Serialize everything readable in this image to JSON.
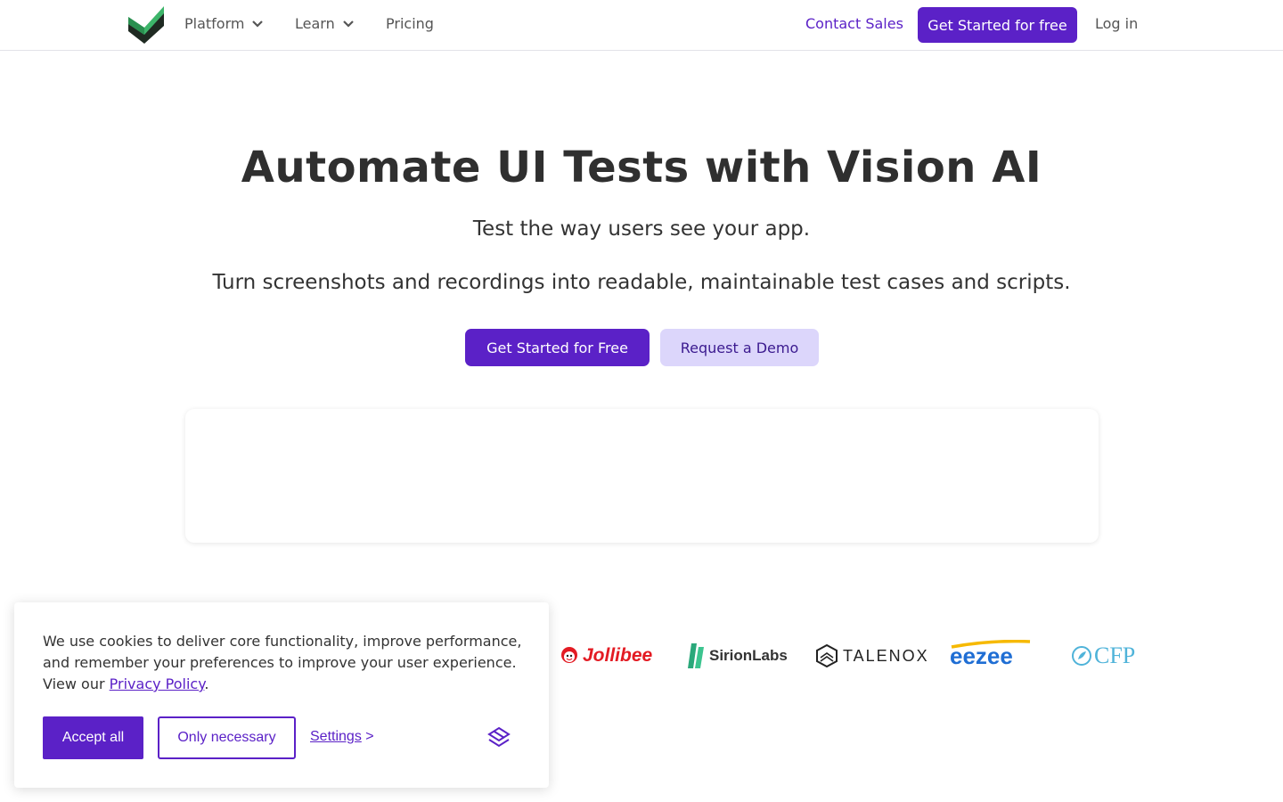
{
  "nav": {
    "logo_icon": "green-check-box-logo",
    "items": [
      {
        "label": "Platform",
        "has_dropdown": true
      },
      {
        "label": "Learn",
        "has_dropdown": true
      },
      {
        "label": "Pricing",
        "has_dropdown": false
      }
    ],
    "contact_sales": "Contact Sales",
    "cta": "Get Started for free",
    "login": "Log in"
  },
  "hero": {
    "title": "Automate UI Tests with Vision AI",
    "subtitle": "Test the way users see your app.",
    "description": "Turn screenshots and recordings into readable, maintainable test cases and scripts.",
    "primary_cta": "Get Started for Free",
    "secondary_cta": "Request a Demo"
  },
  "customers": {
    "logos": [
      {
        "name": "Jollibee"
      },
      {
        "name": "SirionLabs"
      },
      {
        "name": "TALENOX"
      },
      {
        "name": "eezee"
      },
      {
        "name": "CFP"
      }
    ]
  },
  "cookie_banner": {
    "text": "We use cookies to deliver core functionality, improve performance, and remember your preferences to improve your user experience. View our ",
    "link": "Privacy Policy",
    "text_end": ".",
    "accept": "Accept all",
    "necessary": "Only necessary",
    "settings": "Settings",
    "settings_arrow": ">",
    "brand_icon": "layers-brand-icon"
  },
  "colors": {
    "primary": "#5b21c7",
    "secondary_bg": "#dcd6fb",
    "text": "#333333"
  }
}
